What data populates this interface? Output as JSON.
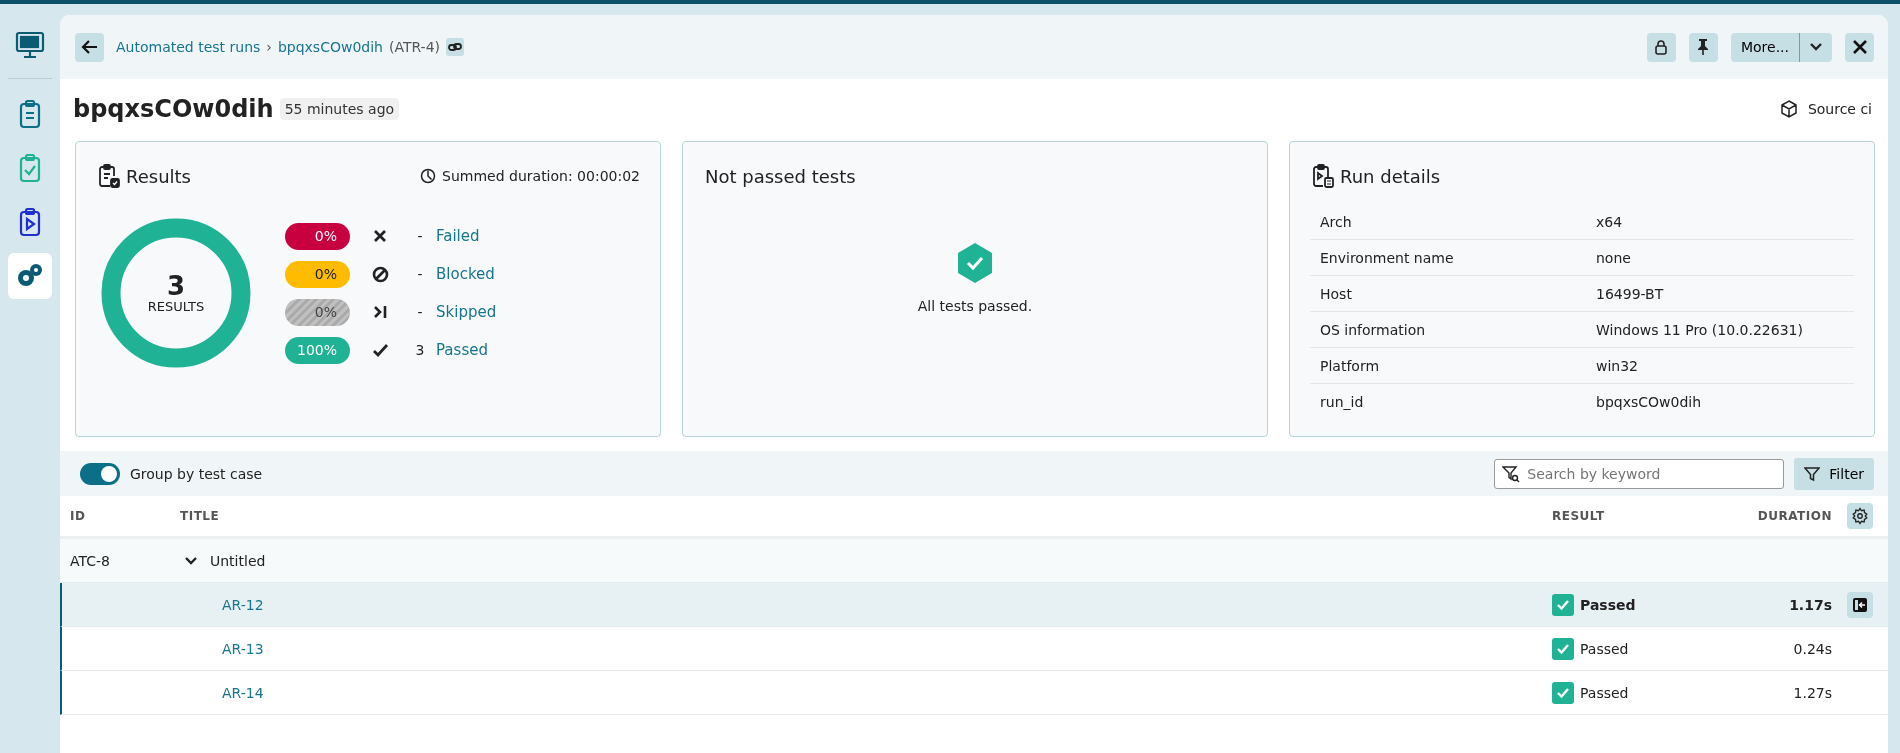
{
  "sidebar": {
    "items": [
      {
        "selected": false
      },
      {
        "selected": false
      },
      {
        "selected": false
      },
      {
        "selected": false
      },
      {
        "selected": true
      }
    ]
  },
  "header": {
    "breadcrumb": [
      {
        "label": "Automated test runs"
      },
      {
        "label": "bpqxsCOw0dih"
      }
    ],
    "breadcrumb_separator": "›",
    "breadcrumb_key": "(ATR-4)",
    "more_button": "More..."
  },
  "title": "bpqxsCOw0dih",
  "time_badge": "55 minutes ago",
  "source": "Source ci",
  "results": {
    "title": "Results",
    "summed_duration": "Summed duration: 00:00:02",
    "total": "3",
    "total_label": "RESULTS",
    "legend": [
      {
        "kind": "failed",
        "percent": "0%",
        "count": "-",
        "label": "Failed",
        "color": "#c8003f"
      },
      {
        "kind": "blocked",
        "percent": "0%",
        "count": "-",
        "label": "Blocked",
        "color": "#ffbb00"
      },
      {
        "kind": "skipped",
        "percent": "0%",
        "count": "-",
        "label": "Skipped",
        "color": "#aaaaaa"
      },
      {
        "kind": "passed",
        "percent": "100%",
        "count": "3",
        "label": "Passed",
        "color": "#20b294"
      }
    ]
  },
  "not_passed": {
    "title": "Not passed tests",
    "message": "All tests passed."
  },
  "run_details": {
    "title": "Run details",
    "rows": [
      {
        "key": "Arch",
        "value": "x64"
      },
      {
        "key": "Environment name",
        "value": "none"
      },
      {
        "key": "Host",
        "value": "16499-BT"
      },
      {
        "key": "OS information",
        "value": "Windows 11 Pro (10.0.22631)"
      },
      {
        "key": "Platform",
        "value": "win32"
      },
      {
        "key": "run_id",
        "value": "bpqxsCOw0dih"
      }
    ]
  },
  "toolbar": {
    "group_toggle": {
      "on": true,
      "label": "Group by test case"
    },
    "search": {
      "placeholder": "Search by keyword"
    },
    "filter_button": "Filter"
  },
  "table": {
    "columns": [
      "ID",
      "TITLE",
      "RESULT",
      "DURATION"
    ],
    "group": {
      "id": "ATC-8",
      "title": "Untitled",
      "expanded": true
    },
    "rows": [
      {
        "title": "AR-12",
        "result": "Passed",
        "duration": "1.17s",
        "selected": true
      },
      {
        "title": "AR-13",
        "result": "Passed",
        "duration": "0.24s",
        "selected": false
      },
      {
        "title": "AR-14",
        "result": "Passed",
        "duration": "1.27s",
        "selected": false
      }
    ]
  }
}
